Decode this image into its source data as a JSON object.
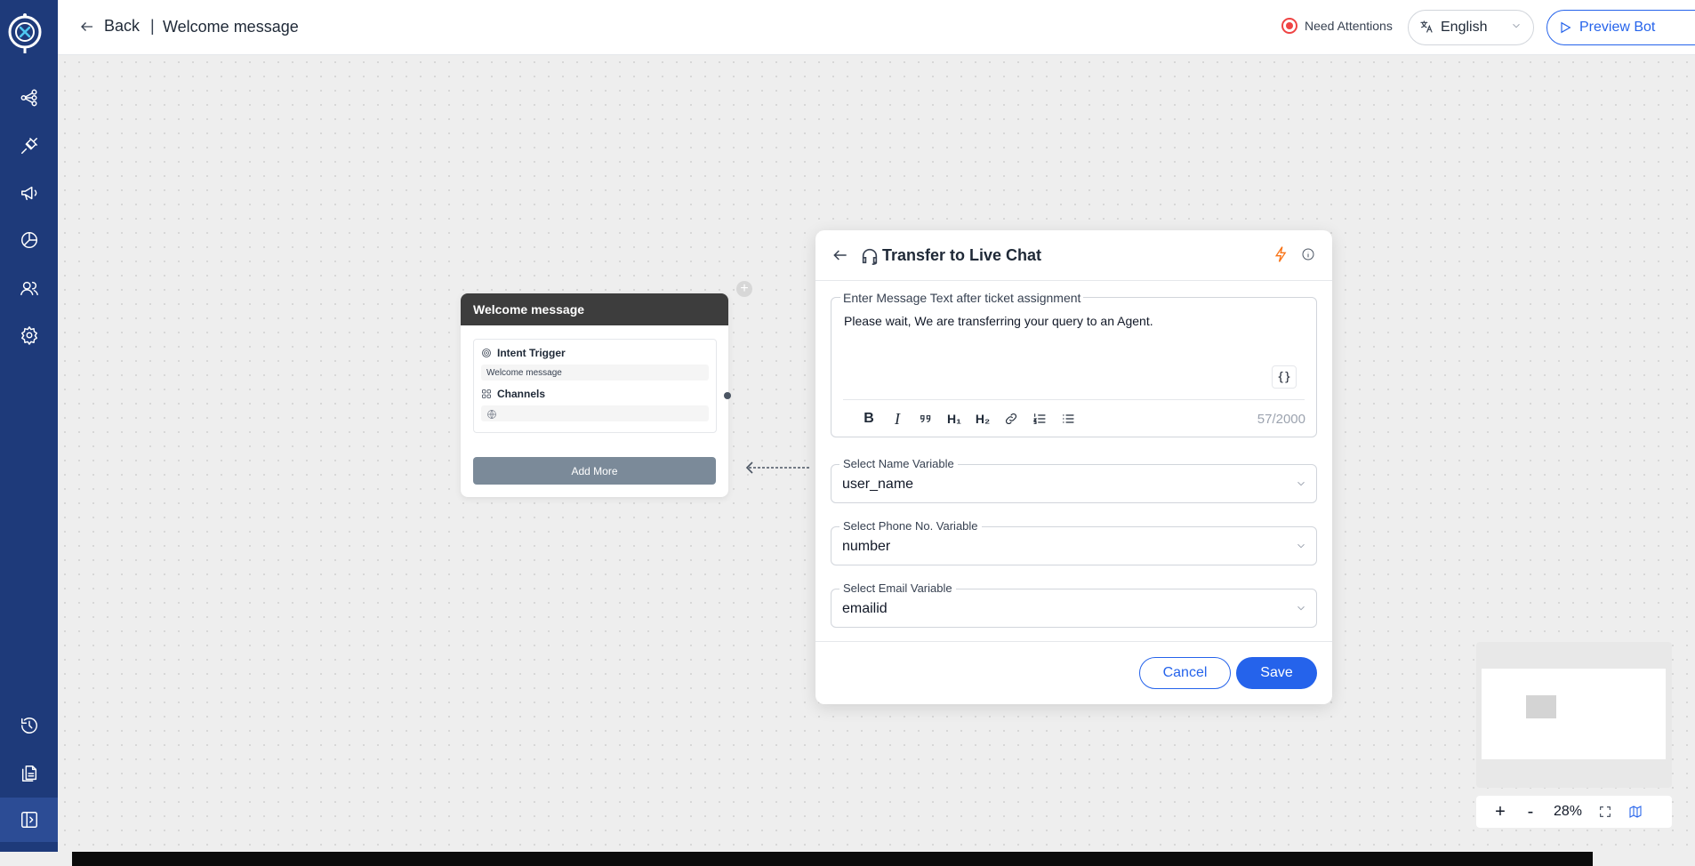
{
  "header": {
    "back_label": "Back",
    "separator": "|",
    "page_title": "Welcome message",
    "attention_label": "Need Attentions",
    "language": {
      "selected": "English",
      "icon": "translate-icon"
    },
    "preview_label": "Preview Bot"
  },
  "sidebar": {
    "items": [
      {
        "name": "flows",
        "icon": "flow-icon"
      },
      {
        "name": "integrations",
        "icon": "plug-icon"
      },
      {
        "name": "broadcast",
        "icon": "megaphone-icon"
      },
      {
        "name": "analytics",
        "icon": "pie-chart-icon"
      },
      {
        "name": "team",
        "icon": "users-icon"
      },
      {
        "name": "settings",
        "icon": "gear-icon"
      },
      {
        "name": "history",
        "icon": "history-icon"
      },
      {
        "name": "documents",
        "icon": "documents-icon"
      },
      {
        "name": "collapse",
        "icon": "collapse-icon"
      }
    ]
  },
  "node": {
    "title": "Welcome message",
    "intent_title": "Intent Trigger",
    "intent_value": "Welcome message",
    "channels_title": "Channels",
    "add_more_label": "Add More"
  },
  "panel": {
    "title": "Transfer to Live Chat",
    "message": {
      "legend": "Enter Message Text after ticket assignment",
      "text": "Please wait, We are transferring your query to an Agent.",
      "variable_button": "{}",
      "counter": "57/2000",
      "toolbar": {
        "bold": "B",
        "italic": "I",
        "h1": "H₁",
        "h2": "H₂"
      }
    },
    "fields": [
      {
        "label": "Select Name Variable",
        "value": "user_name"
      },
      {
        "label": "Select Phone No. Variable",
        "value": "number"
      },
      {
        "label": "Select Email Variable",
        "value": "emailid"
      }
    ],
    "cancel_label": "Cancel",
    "save_label": "Save"
  },
  "zoom": {
    "plus": "+",
    "minus": "-",
    "level": "28%"
  },
  "colors": {
    "sidebar": "#1e3a7a",
    "accent": "#2563eb",
    "alert": "#ef4444",
    "bolt": "#f97316",
    "node_header": "#3d3d3d"
  }
}
